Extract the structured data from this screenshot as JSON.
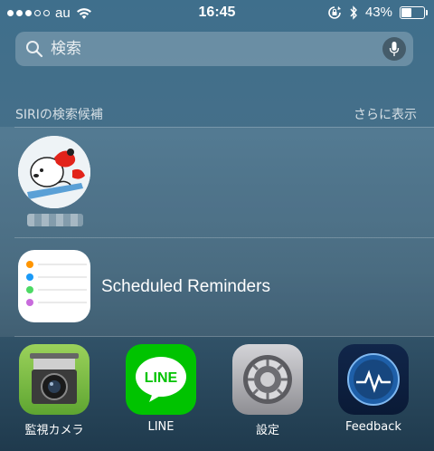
{
  "status_bar": {
    "carrier": "au",
    "time": "16:45",
    "battery_percent": "43%",
    "battery_level": 0.43,
    "signal_filled": 3,
    "signal_total": 5
  },
  "search": {
    "placeholder": "検索"
  },
  "siri_section": {
    "title": "SIRIの検索候補",
    "more_label": "さらに表示"
  },
  "contact": {
    "name": "■■■■■■"
  },
  "reminder": {
    "title": "Scheduled Reminders"
  },
  "apps": [
    {
      "label": "監視カメラ",
      "icon": "security-camera-icon"
    },
    {
      "label": "LINE",
      "icon": "line-icon",
      "icon_text": "LINE"
    },
    {
      "label": "設定",
      "icon": "gear-icon"
    },
    {
      "label": "Feedback",
      "icon": "feedback-icon"
    }
  ],
  "colors": {
    "line_green": "#00c300",
    "camera_green": "#7ac143",
    "feedback_blue": "#1e5fa8"
  }
}
